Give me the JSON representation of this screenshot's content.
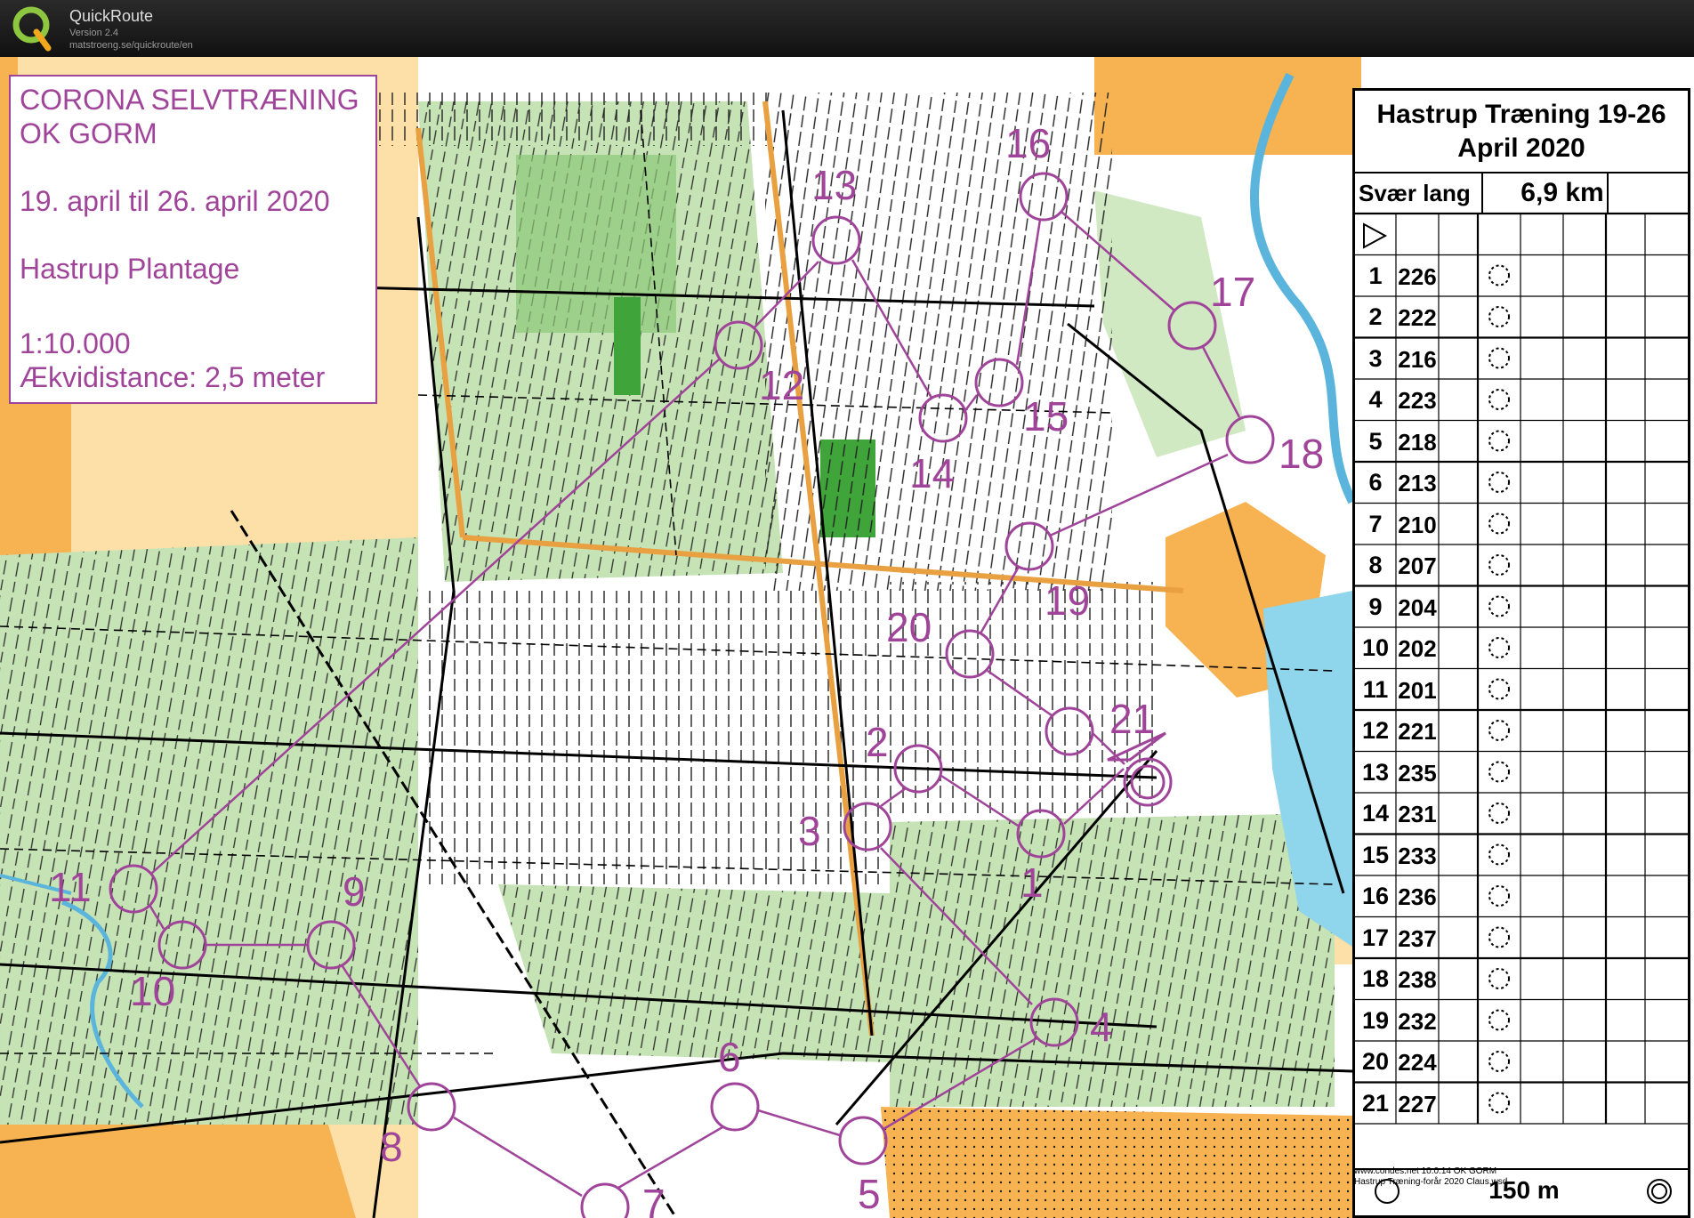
{
  "app": {
    "name": "QuickRoute",
    "version": "Version 2.4",
    "url": "matstroeng.se/quickroute/en"
  },
  "map_info": {
    "line1": "CORONA SELVTRÆNING",
    "line2": "OK GORM",
    "dates": "19. april til 26. april 2020",
    "place": "Hastrup Plantage",
    "scale": "1:10.000",
    "contour": "Ækvidistance: 2,5 meter"
  },
  "description_sheet": {
    "title_line1": "Hastrup Træning 19-26",
    "title_line2": "April 2020",
    "course_class": "Svær lang",
    "course_length": "6,9 km",
    "controls": [
      {
        "n": "1",
        "code": "226"
      },
      {
        "n": "2",
        "code": "222"
      },
      {
        "n": "3",
        "code": "216"
      },
      {
        "n": "4",
        "code": "223"
      },
      {
        "n": "5",
        "code": "218"
      },
      {
        "n": "6",
        "code": "213"
      },
      {
        "n": "7",
        "code": "210"
      },
      {
        "n": "8",
        "code": "207"
      },
      {
        "n": "9",
        "code": "204"
      },
      {
        "n": "10",
        "code": "202"
      },
      {
        "n": "11",
        "code": "201"
      },
      {
        "n": "12",
        "code": "221"
      },
      {
        "n": "13",
        "code": "235"
      },
      {
        "n": "14",
        "code": "231"
      },
      {
        "n": "15",
        "code": "233"
      },
      {
        "n": "16",
        "code": "236"
      },
      {
        "n": "17",
        "code": "237"
      },
      {
        "n": "18",
        "code": "238"
      },
      {
        "n": "19",
        "code": "232"
      },
      {
        "n": "20",
        "code": "224"
      },
      {
        "n": "21",
        "code": "227"
      }
    ],
    "finish_distance": "150 m",
    "credit_line1": "www.condes.net 10.0.14 OK GORM",
    "credit_line2": "Hastrup Træning-forår 2020 Claus.wsd"
  },
  "course_labels": [
    "1",
    "2",
    "3",
    "4",
    "5",
    "6",
    "7",
    "8",
    "9",
    "10",
    "11",
    "12",
    "13",
    "14",
    "15",
    "16",
    "17",
    "18",
    "19",
    "20",
    "21"
  ],
  "colors": {
    "course": "#a0449a",
    "forest_light": "#c5e3b4",
    "forest_mid": "#8cc878",
    "forest_dark": "#3fa43a",
    "open_land": "#f7b351",
    "rough_open": "#fde0a8",
    "water": "#8fd5ec"
  }
}
